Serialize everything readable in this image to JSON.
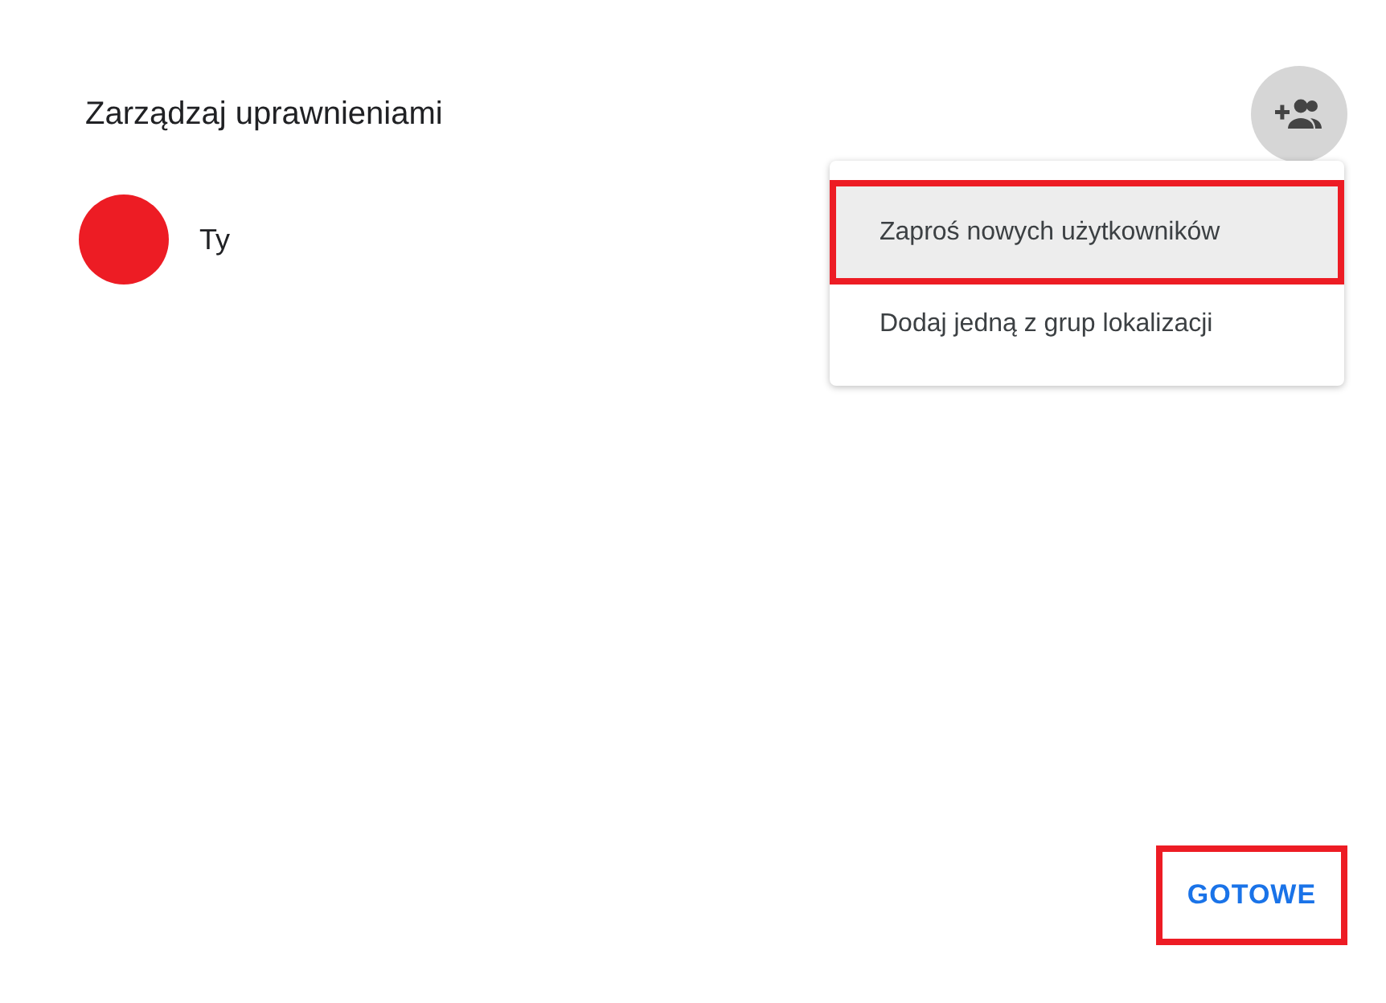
{
  "dialog": {
    "title": "Zarządzaj uprawnieniami"
  },
  "add_button": {
    "highlighted": false
  },
  "members": [
    {
      "name": "Ty",
      "color": "#ed1c24"
    }
  ],
  "menu": {
    "items": [
      {
        "label": "Zaproś nowych użytkowników",
        "hovered": true,
        "highlighted": true
      },
      {
        "label": "Dodaj jedną z grup lokalizacji",
        "hovered": false,
        "highlighted": false
      }
    ]
  },
  "done_button": {
    "label": "GOTOWE",
    "highlighted": true
  }
}
